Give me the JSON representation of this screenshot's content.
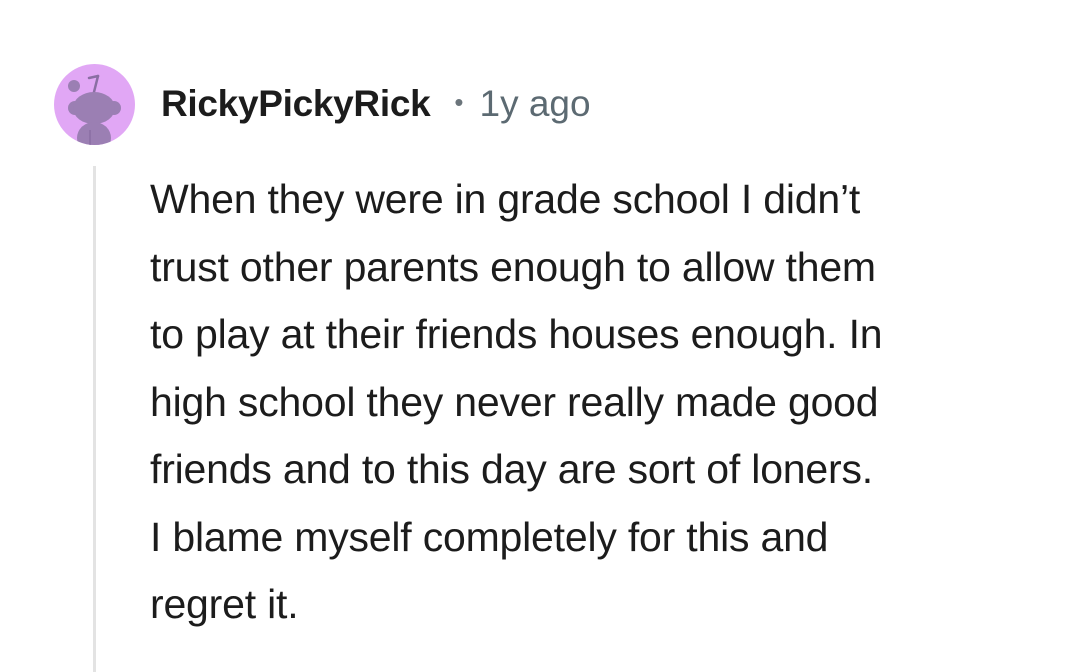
{
  "comment": {
    "username": "RickyPickyRick",
    "separator": "•",
    "timestamp": "1y ago",
    "body_lines": [
      "When they were in grade school I didn’t",
      "trust other parents enough to allow them",
      "to play at their friends houses enough. In",
      "high school they never really made good",
      "friends and to this day are sort of loners.",
      "I blame myself completely for this and",
      "regret it."
    ]
  },
  "avatar": {
    "icon": "snoo-avatar-icon",
    "background_color": "#e1a7f5",
    "figure_color": "#9b7fb3"
  },
  "colors": {
    "text": "#1c1c1c",
    "meta": "#5c6a72",
    "thread_line": "#e3e3e3",
    "background": "#ffffff"
  }
}
